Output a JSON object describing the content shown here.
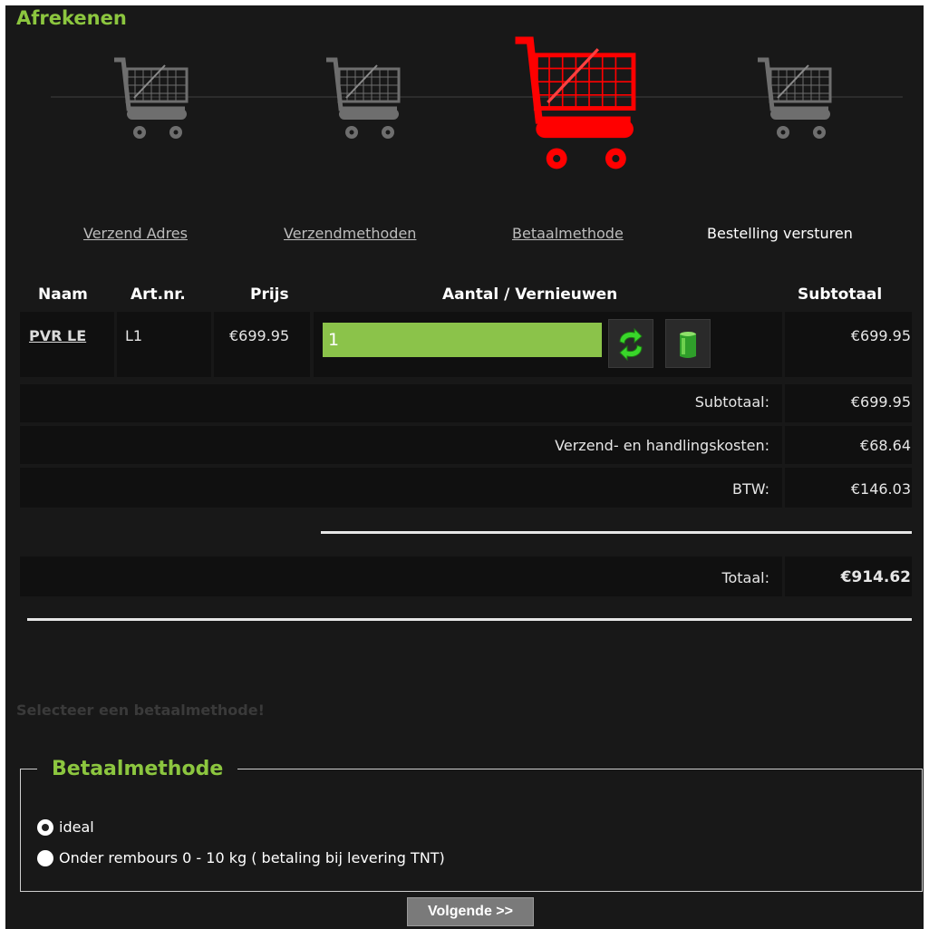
{
  "page": {
    "title": "Afrekenen"
  },
  "steps": [
    {
      "label": "Verzend Adres",
      "state": "done"
    },
    {
      "label": "Verzendmethoden",
      "state": "done"
    },
    {
      "label": "Betaalmethode",
      "state": "current"
    },
    {
      "label": "Bestelling versturen",
      "state": "todo"
    }
  ],
  "colors": {
    "accent": "#8cc63f",
    "active_cart": "#ff0000",
    "inactive_cart": "#6e6e6e",
    "qty_field": "#8bc34a"
  },
  "table": {
    "headers": {
      "name": "Naam",
      "art": "Art.nr.",
      "price": "Prijs",
      "qty": "Aantal / Vernieuwen",
      "subtotal": "Subtotaal"
    },
    "rows": [
      {
        "name": "PVR LE",
        "art": "L1",
        "price": "€699.95",
        "qty": "1",
        "subtotal": "€699.95"
      }
    ]
  },
  "icons": {
    "update": "refresh-icon",
    "delete": "trash-can-icon",
    "cart": "shopping-cart-icon"
  },
  "totals": {
    "subtotal_label": "Subtotaal:",
    "subtotal_value": "€699.95",
    "shipping_label": "Verzend- en handlingskosten:",
    "shipping_value": "€68.64",
    "vat_label": "BTW:",
    "vat_value": "€146.03",
    "total_label": "Totaal:",
    "total_value": "€914.62"
  },
  "warning": "Selecteer een betaalmethode!",
  "payment": {
    "legend": "Betaalmethode",
    "options": [
      {
        "label": "ideal",
        "selected": true
      },
      {
        "label": "Onder rembours 0 - 10 kg ( betaling bij levering TNT)",
        "selected": false
      }
    ]
  },
  "next_button": "Volgende >>"
}
